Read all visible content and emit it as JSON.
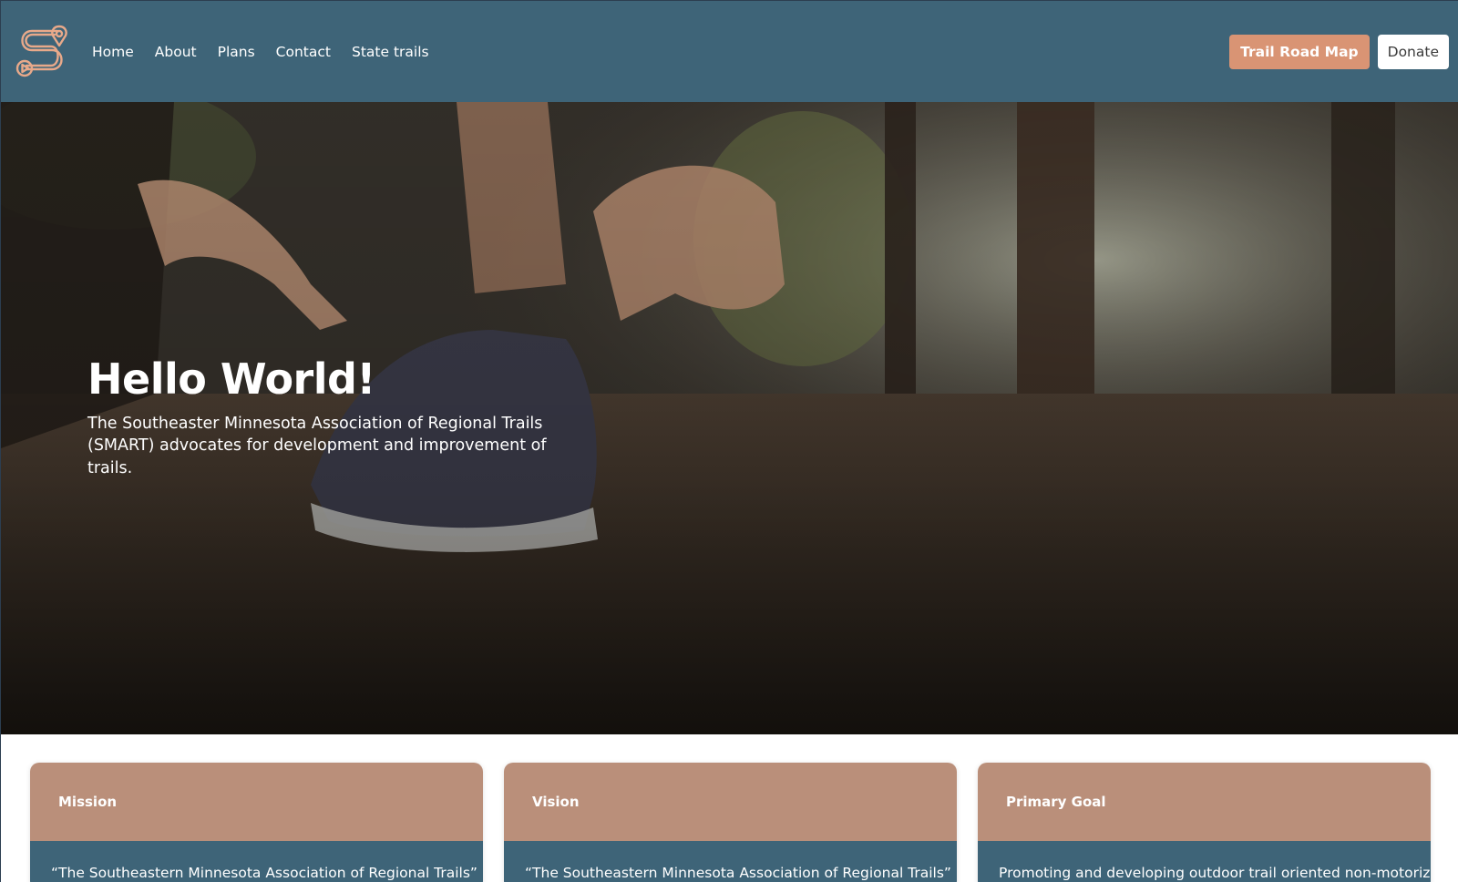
{
  "nav": {
    "links": [
      "Home",
      "About",
      "Plans",
      "Contact",
      "State trails"
    ],
    "trail_map_label": "Trail Road Map",
    "donate_label": "Donate"
  },
  "hero": {
    "title": "Hello World!",
    "subtitle": "The Southeaster Minnesota Association of Regional Trails (SMART) advocates for development and improvement of trails."
  },
  "cards": [
    {
      "title": "Mission",
      "body": "“The Southeastern Minnesota Association of Regional Trails”"
    },
    {
      "title": "Vision",
      "body": "“The Southeastern Minnesota Association of Regional Trails”"
    },
    {
      "title": "Primary Goal",
      "body": "Promoting and developing outdoor trail oriented non-motorized"
    }
  ],
  "colors": {
    "navbar": "#3e6478",
    "accent_button": "#d99474",
    "card_header": "#ba8f7a",
    "card_body": "#3e6478"
  },
  "icons": {
    "logo": "trail-path-logo-icon"
  }
}
